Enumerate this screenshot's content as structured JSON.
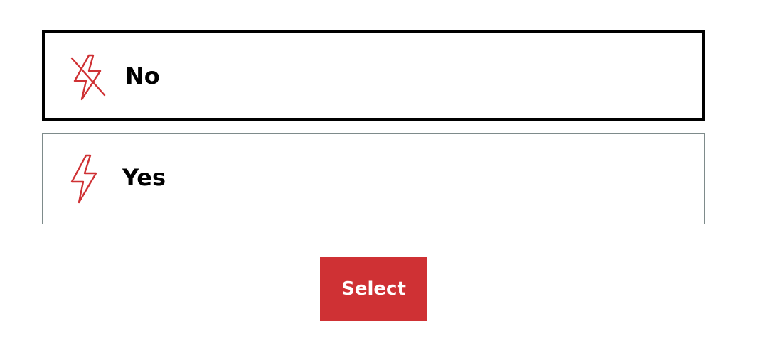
{
  "options": [
    {
      "label": "No",
      "icon": "lightning-off-icon",
      "selected": true
    },
    {
      "label": "Yes",
      "icon": "lightning-icon",
      "selected": false
    }
  ],
  "select_button": {
    "label": "Select"
  },
  "colors": {
    "accent": "#cf3134",
    "selected_border": "#000000",
    "unselected_border": "#7e8b8b",
    "text": "#000000",
    "button_text": "#ffffff"
  }
}
